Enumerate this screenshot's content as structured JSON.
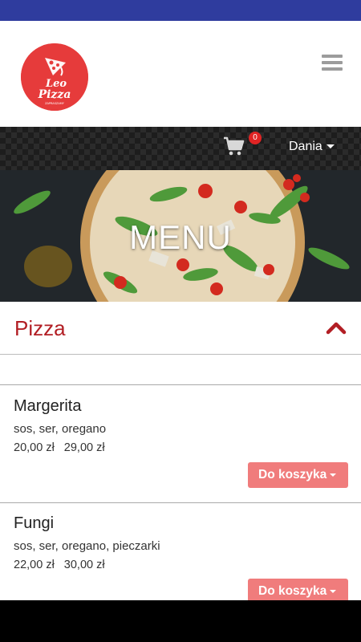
{
  "header": {
    "logo_text": "Leo Pizza",
    "logo_subtext": "ZAPRASZAMY",
    "menu_icon": "hamburger-menu-icon"
  },
  "navbar": {
    "cart_icon": "shopping-cart-icon",
    "cart_count": "0",
    "language_label": "Dania"
  },
  "hero": {
    "title": "MENU"
  },
  "category": {
    "title": "Pizza",
    "chevron_icon": "chevron-up-icon",
    "accent_color": "#b21e24"
  },
  "items": [
    {
      "name": "Margerita",
      "description": "sos, ser, oregano",
      "prices": [
        "20,00 zł",
        "29,00 zł"
      ],
      "button_label": "Do koszyka"
    },
    {
      "name": "Fungi",
      "description": "sos, ser, oregano, pieczarki",
      "prices": [
        "22,00 zł",
        "30,00 zł"
      ],
      "button_label": "Do koszyka"
    }
  ],
  "colors": {
    "status_bar": "#2f3c9e",
    "button": "#f07c7c",
    "badge": "#e02424"
  }
}
